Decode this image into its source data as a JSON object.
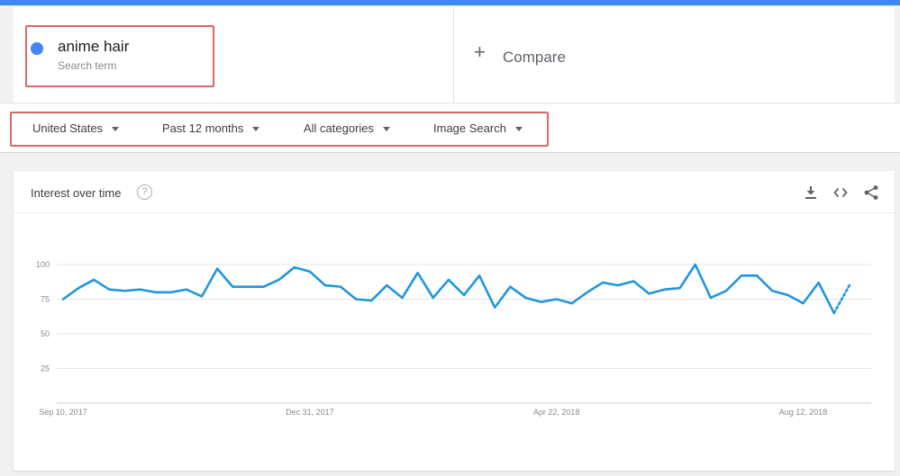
{
  "search_term": {
    "name": "anime hair",
    "subtitle": "Search term",
    "color": "#4285f4"
  },
  "compare": {
    "plus": "+",
    "label": "Compare"
  },
  "filters": {
    "region": "United States",
    "time_range": "Past 12 months",
    "category": "All categories",
    "search_type": "Image Search"
  },
  "card": {
    "title": "Interest over time",
    "help": "?",
    "icons": [
      "download-icon",
      "embed-icon",
      "share-icon"
    ]
  },
  "chart_data": {
    "type": "line",
    "title": "Interest over time",
    "ylim": [
      0,
      100
    ],
    "yticks": [
      25,
      50,
      75,
      100
    ],
    "xticks": [
      "Sep 10, 2017",
      "Dec 31, 2017",
      "Apr 22, 2018",
      "Aug 12, 2018"
    ],
    "grid": true,
    "color": "#2196e0",
    "series": [
      {
        "name": "anime hair",
        "values": [
          75,
          83,
          89,
          82,
          81,
          82,
          80,
          80,
          82,
          77,
          97,
          84,
          84,
          84,
          89,
          98,
          95,
          85,
          84,
          75,
          74,
          85,
          76,
          94,
          76,
          89,
          78,
          92,
          69,
          84,
          76,
          73,
          75,
          72,
          80,
          87,
          85,
          88,
          79,
          82,
          83,
          100,
          76,
          81,
          92,
          92,
          81,
          78,
          72,
          87,
          65
        ],
        "partial_values": [
          65,
          85
        ]
      }
    ]
  }
}
